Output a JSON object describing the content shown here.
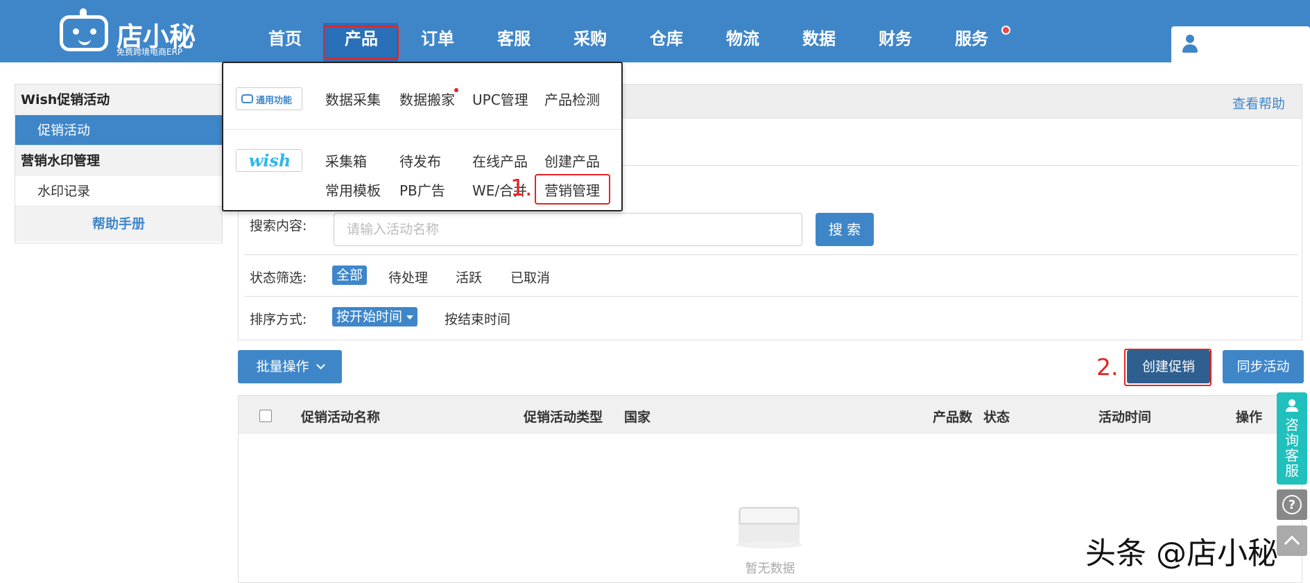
{
  "app": {
    "logo_name": "店小秘",
    "logo_sub": "免费跨境电商ERP"
  },
  "nav": {
    "items": [
      "首页",
      "产品",
      "订单",
      "客服",
      "采购",
      "仓库",
      "物流",
      "数据",
      "财务",
      "服务"
    ],
    "active": "产品"
  },
  "sidebar": {
    "groups": [
      {
        "title": "Wish促销活动",
        "items": [
          "促销活动"
        ]
      },
      {
        "title": "营销水印管理",
        "items": [
          "水印记录"
        ]
      }
    ],
    "active_item": "促销活动",
    "help": "帮助手册"
  },
  "header": {
    "help_link": "查看帮助"
  },
  "filters": {
    "search_label": "搜索内容:",
    "search_placeholder": "请输入活动名称",
    "search_button": "搜 索",
    "status_label": "状态筛选:",
    "status_options": [
      "全部",
      "待处理",
      "活跃",
      "已取消"
    ],
    "status_selected": "全部",
    "sort_label": "排序方式:",
    "sort_options": [
      "按开始时间",
      "按结束时间"
    ],
    "sort_selected": "按开始时间"
  },
  "toolbar": {
    "batch": "批量操作",
    "create": "创建促销",
    "sync": "同步活动"
  },
  "table": {
    "columns": [
      "促销活动名称",
      "促销活动类型",
      "国家",
      "产品数",
      "状态",
      "活动时间",
      "操作"
    ],
    "empty_text": "暂无数据"
  },
  "dropdown": {
    "common_tag": "通用功能",
    "common_items": [
      "数据采集",
      "数据搬家",
      "UPC管理",
      "产品检测"
    ],
    "wish_tag": "wish",
    "wish_items_row1": [
      "采集箱",
      "待发布",
      "在线产品",
      "创建产品"
    ],
    "wish_items_row2": [
      "常用模板",
      "PB广告",
      "WE/合并",
      "营销管理"
    ]
  },
  "annotations": {
    "step1": "1.",
    "step2": "2."
  },
  "floating": {
    "consult": "咨询客服",
    "help": "?"
  },
  "watermark": "头条 @店小秘",
  "colors": {
    "brand": "#3f86c9",
    "highlight": "#e52222",
    "consult": "#20c0bd"
  }
}
